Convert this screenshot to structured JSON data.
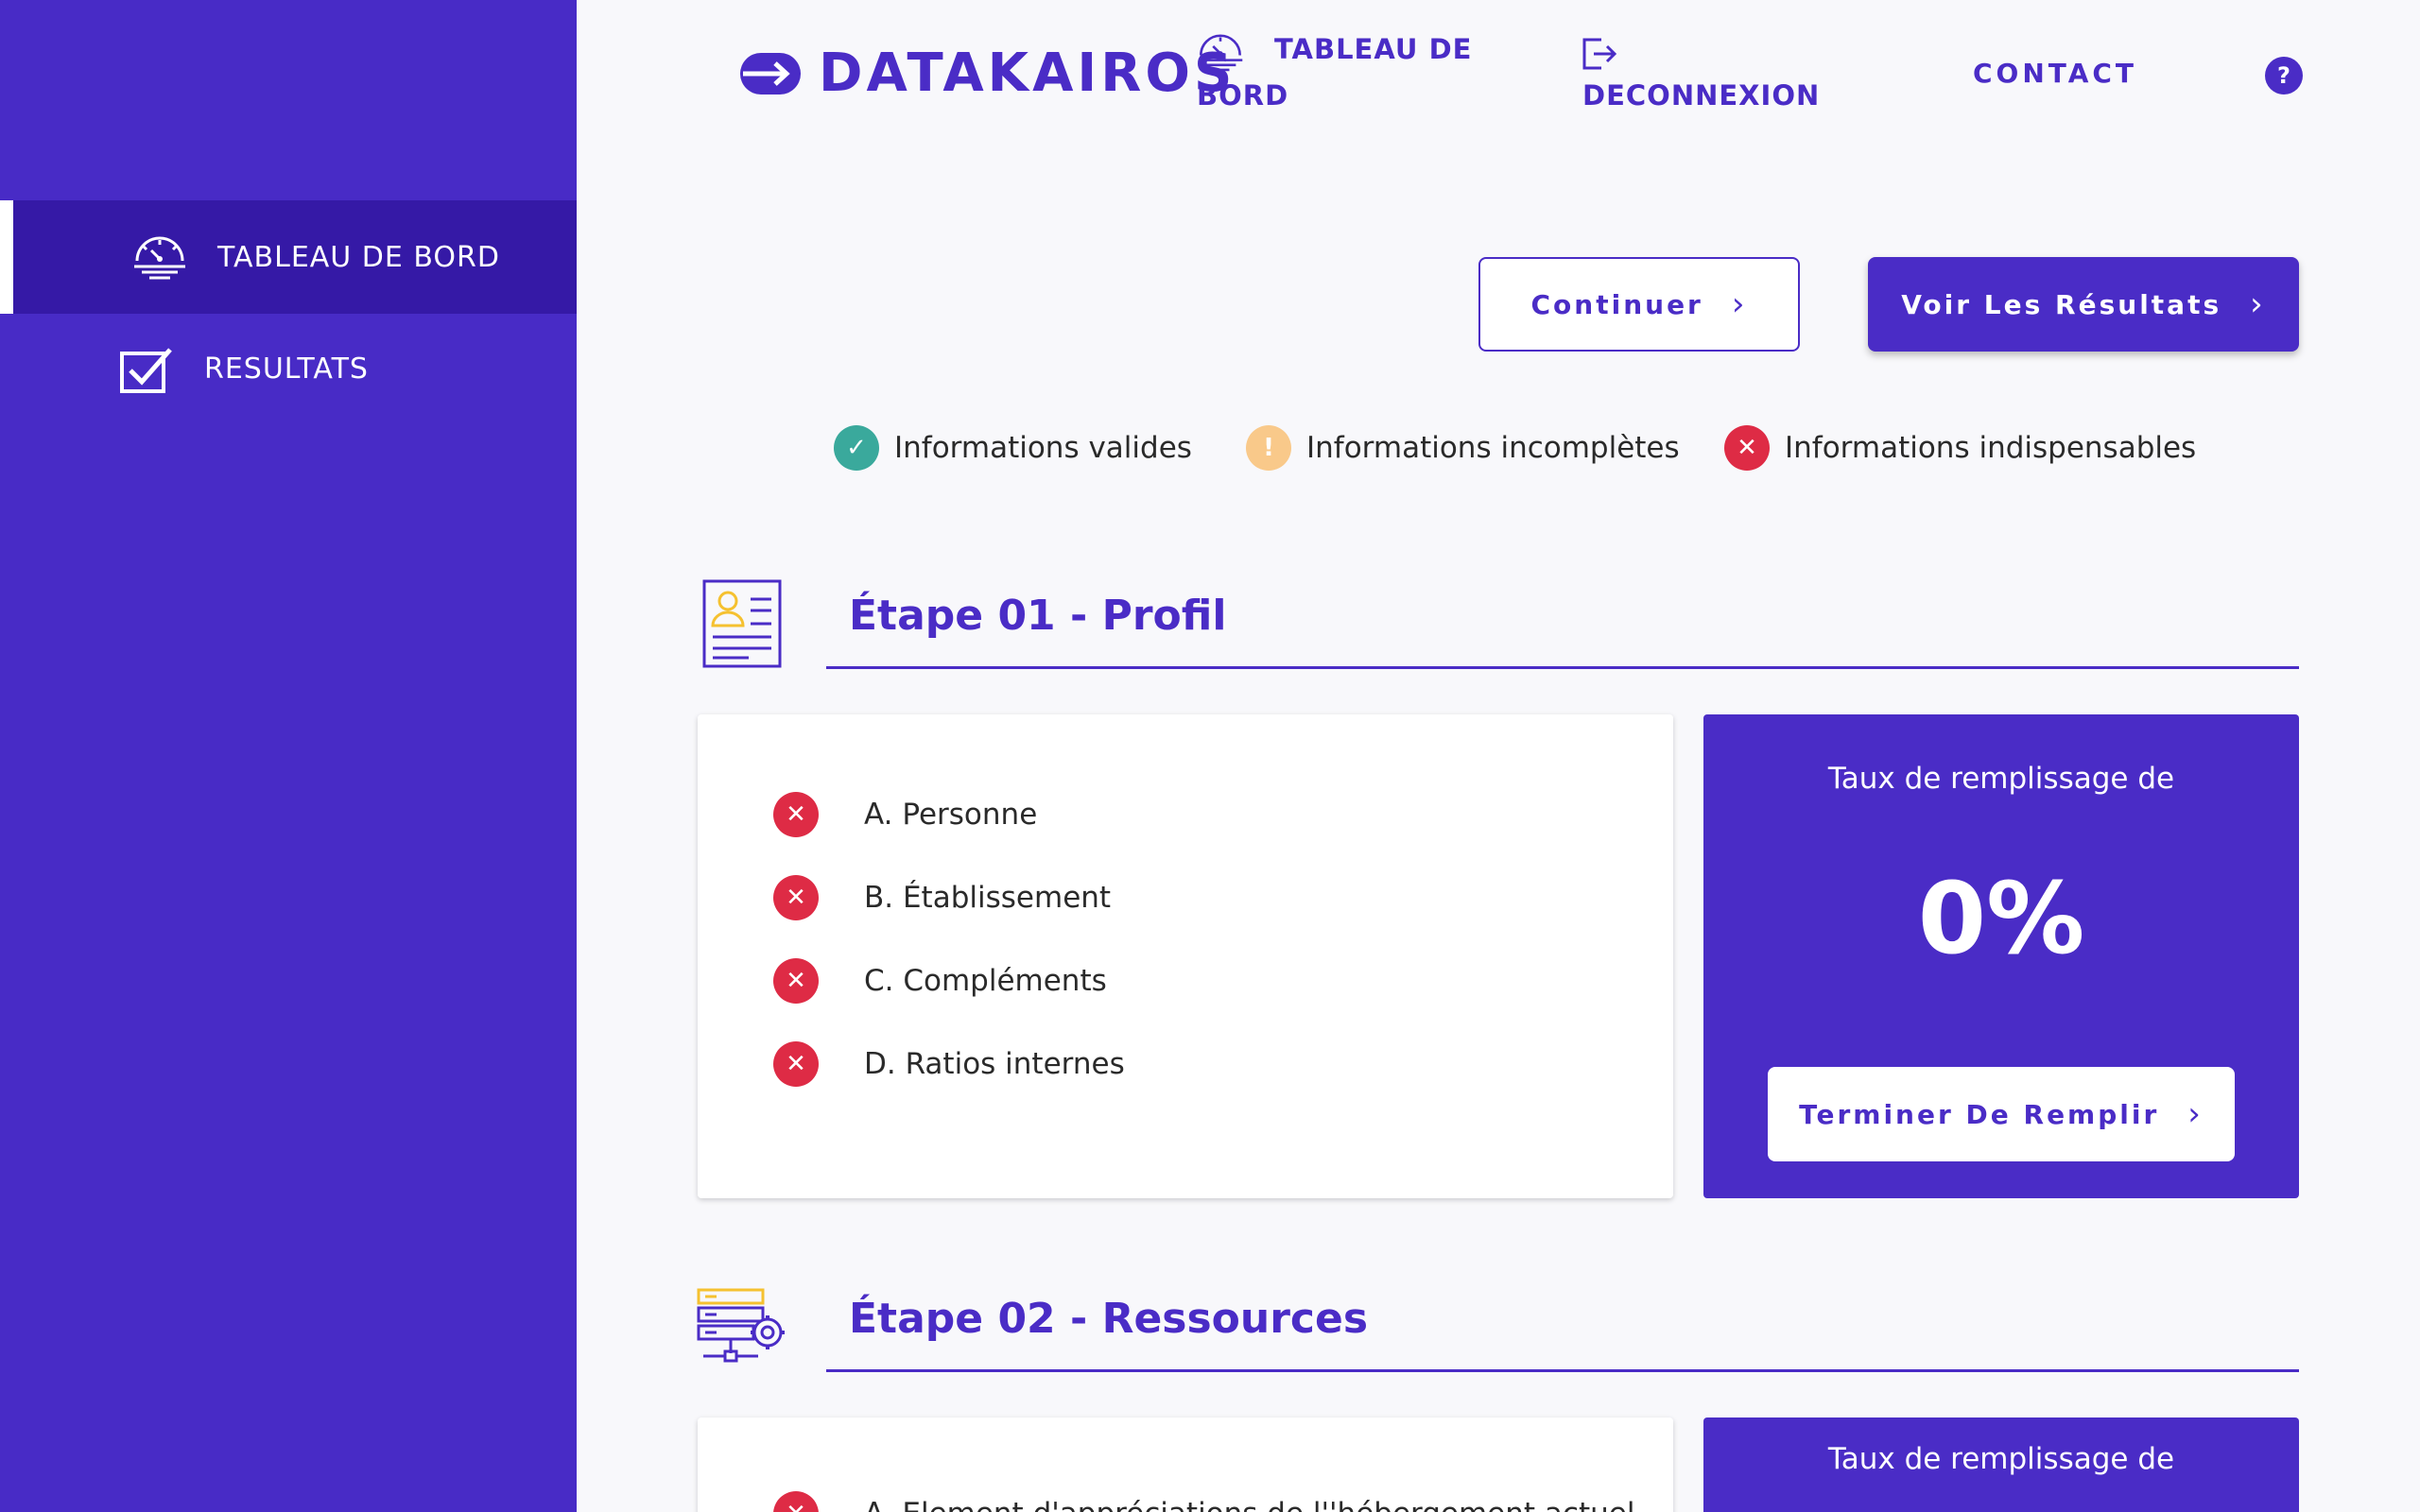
{
  "colors": {
    "primary": "#4a2cc6",
    "sidebar": "#482bc6",
    "sidebar_active": "#3519a6",
    "valid": "#3aa99c",
    "incomplete": "#f9c98a",
    "required": "#de2b45",
    "accent_yellow": "#f5c130"
  },
  "sidebar": {
    "items": [
      {
        "label": "TABLEAU DE BORD",
        "icon": "dashboard-gauge-icon"
      },
      {
        "label": "RESULTATS",
        "icon": "checkbox-icon"
      }
    ]
  },
  "header": {
    "brand": "DATAKAIROS",
    "brand_icon": "datakairos-logo-icon",
    "nav": {
      "dashboard_line1": "TABLEAU DE",
      "dashboard_line2": "BORD",
      "logout": "DECONNEXION",
      "contact": "CONTACT",
      "help": "?"
    }
  },
  "actions": {
    "continue_label": "Continuer",
    "results_label": "Voir Les Résultats",
    "chevron": "›"
  },
  "legend": {
    "valid": {
      "label": "Informations valides",
      "glyph": "✓"
    },
    "incomplete": {
      "label": "Informations incomplètes",
      "glyph": "!"
    },
    "required": {
      "label": "Informations indispensables",
      "glyph": "✕"
    }
  },
  "steps": [
    {
      "title": "Étape 01 - Profil",
      "icon": "profile-card-icon",
      "items": [
        "A. Personne",
        "B. Établissement",
        "C. Compléments",
        "D. Ratios internes"
      ],
      "rate_label": "Taux de remplissage de",
      "rate_value": "0%",
      "rate_button": "Terminer De Remplir"
    },
    {
      "title": "Étape 02 - Ressources",
      "icon": "server-gear-icon",
      "items": [
        "A. Element d'appréciations de l''hébergement actuel"
      ],
      "rate_label": "Taux de remplissage de"
    }
  ]
}
